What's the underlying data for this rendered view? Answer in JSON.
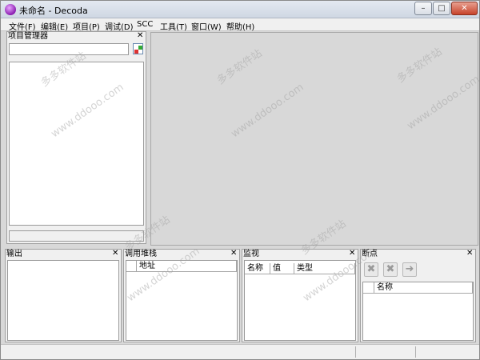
{
  "window": {
    "title": "未命名 - Decoda",
    "controls": {
      "minimize": "–",
      "maximize": "□",
      "close": "✕"
    }
  },
  "menu": [
    "文件(F)",
    "编辑(E)",
    "项目(P)",
    "调试(D)",
    "SCC",
    "工具(T)",
    "窗口(W)",
    "帮助(H)"
  ],
  "project_manager": {
    "title": "项目管理器",
    "close": "✕",
    "search_value": ""
  },
  "output": {
    "title": "输出",
    "close": "✕"
  },
  "call_stack": {
    "title": "调用堆栈",
    "close": "✕",
    "columns": [
      "地址"
    ]
  },
  "watch": {
    "title": "监视",
    "close": "✕",
    "columns": [
      "名称",
      "值",
      "类型"
    ]
  },
  "breakpoints": {
    "title": "断点",
    "close": "✕",
    "columns": [
      "名称"
    ]
  },
  "watermark": {
    "text1": "多多软件站",
    "text2": "www.ddooo.com"
  },
  "colors": {
    "accent_icon": "#8a1cb0",
    "close_button": "#c7432b"
  }
}
